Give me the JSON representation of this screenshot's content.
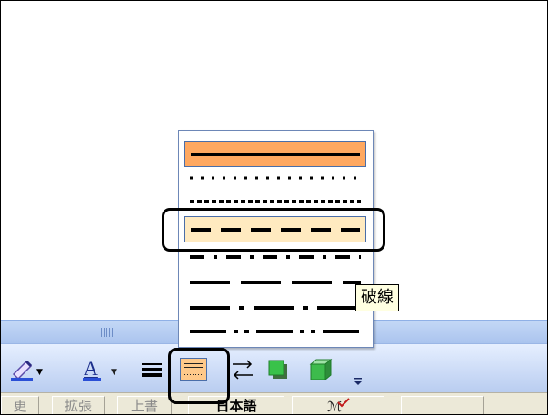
{
  "toolbar": {
    "buttons": [
      {
        "name": "line-color-button",
        "icon": "pen-icon"
      },
      {
        "name": "font-color-button",
        "label": "A"
      },
      {
        "name": "line-style-button",
        "icon": "line-style-icon"
      },
      {
        "name": "dash-style-button",
        "icon": "dash-style-icon"
      },
      {
        "name": "arrow-style-button",
        "icon": "arrow-style-icon"
      },
      {
        "name": "shadow-style-button",
        "icon": "shadow-icon"
      },
      {
        "name": "3d-style-button",
        "icon": "3d-cube-icon"
      },
      {
        "name": "toolbar-options-button",
        "icon": "chevron-down-icon"
      }
    ],
    "font_color_label": "A",
    "accent_color": "#2a4fd6"
  },
  "dash_menu": {
    "items": [
      "solid",
      "round-dot",
      "square-dot",
      "dash",
      "dash-dot",
      "long-dash",
      "long-dash-dot",
      "long-dash-dot-dot"
    ],
    "selected": "solid",
    "hovered": "dash",
    "tooltip": "破線"
  },
  "statusbar": {
    "items": [
      {
        "label": "更",
        "active": false
      },
      {
        "label": "拡張",
        "active": false
      },
      {
        "label": "上書",
        "active": false
      },
      {
        "label": "日本語",
        "active": true
      },
      {
        "label": "",
        "active": false
      }
    ]
  },
  "colors": {
    "selected_bg": "#ffa860",
    "hover_bg": "#ffeac0",
    "toolbar_bg": "#cddcf7",
    "tooltip_bg": "#ffffe1"
  }
}
